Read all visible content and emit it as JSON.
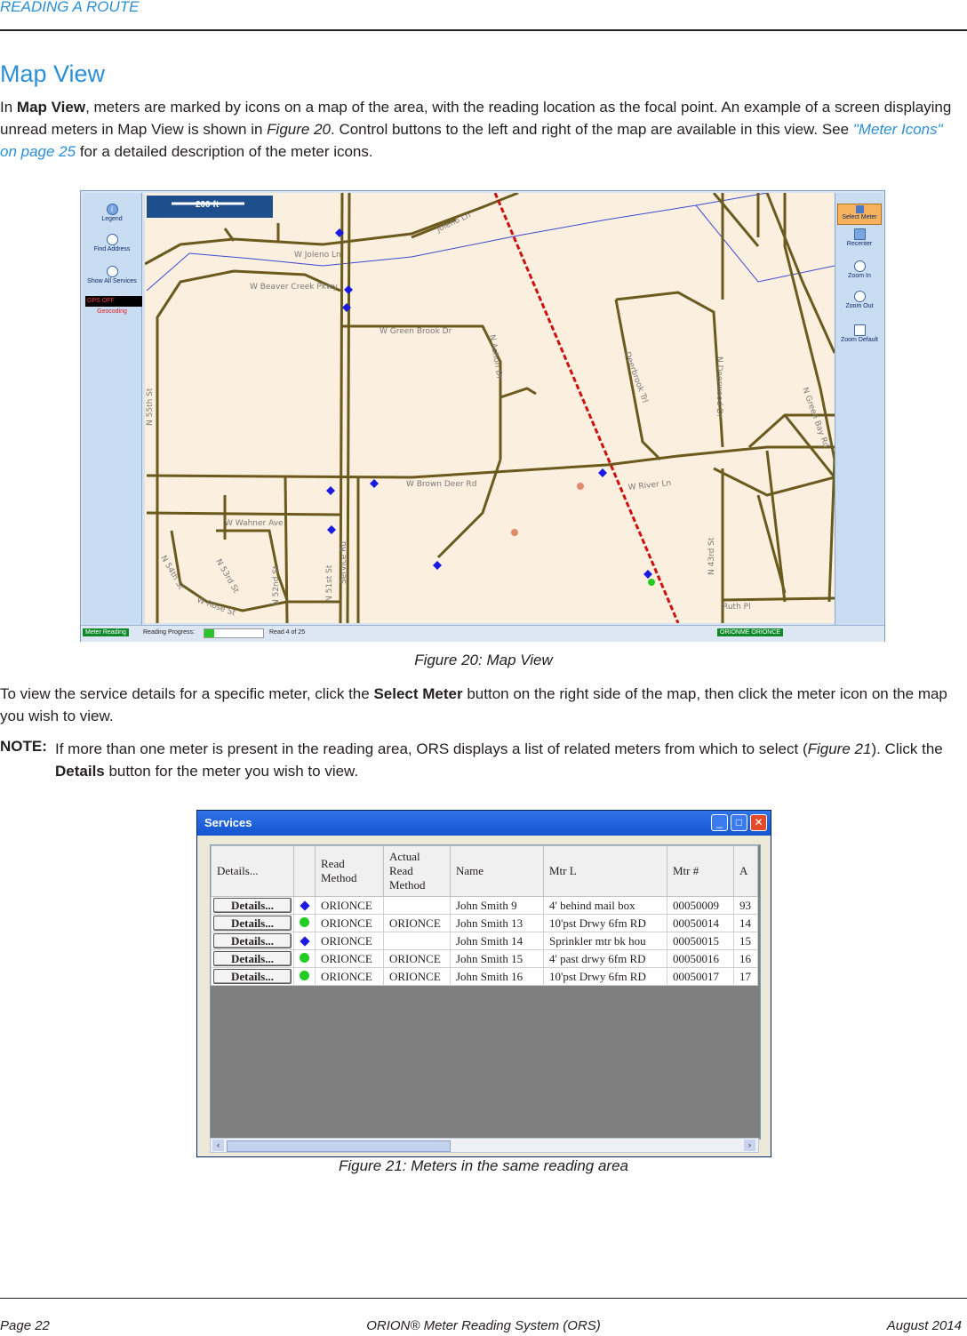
{
  "header": {
    "section": "READING A ROUTE"
  },
  "title": "Map View",
  "intro": {
    "p1_a": "In ",
    "p1_bold": "Map View",
    "p1_b": ", meters are marked by icons on a map of the area, with the reading location as the focal point. An example of a screen displaying unread meters in Map View is shown in ",
    "p1_fig": "Figure 20",
    "p1_c": ". Control buttons to the left and right of the map are available in this view. See ",
    "p1_link": "\"Meter Icons\" on page 25",
    "p1_d": " for a detailed description of the meter icons."
  },
  "figure20": {
    "caption": "Figure 20:  Map View",
    "scale": "200 ft",
    "left_tools": [
      "Legend",
      "Find Address",
      "Show All Services"
    ],
    "gps": "GPS OFF",
    "geocoding": "Geocoding",
    "right_tools": {
      "select": "Select Meter",
      "recenter": "Recenter",
      "zoom_in": "Zoom In",
      "zoom_out": "Zoom Out",
      "zoom_default": "Zoom Default"
    },
    "streets": {
      "joleno": "W Joleno Ln",
      "joleno2": "Joleno Ln",
      "beaver": "W Beaver Creek Pkwy",
      "greenbrook": "W Green Brook Dr",
      "ashon": "N Ashon Dr",
      "deerbrook": "Deerbrook Trl",
      "deerwood": "N Deerwood Dr",
      "greenbay": "N Green Bay Rd",
      "n55": "N 55th St",
      "browndeer": "W Brown Deer Rd",
      "river": "W River Ln",
      "wahner": "W Wahner Ave",
      "n54": "N 54th St",
      "n53": "N 53rd St",
      "n52": "N 52nd St",
      "n51": "N 51st St",
      "service": "Service Rd",
      "rose": "W Rose St",
      "n43": "N 43rd St",
      "ruth": "Ruth Pl"
    },
    "status": {
      "mode": "Meter Reading",
      "progress_label": "Reading Progress:",
      "progress_fraction": 0.16,
      "count": "Read 4 of 25",
      "method": "ORIONME  ORIONCE"
    }
  },
  "para2": {
    "a": "To view the service details for a specific meter, click the ",
    "bold": "Select Meter",
    "b": " button on the right side of the map, then click the meter icon on the map you wish to view."
  },
  "note": {
    "label": "NOTE:",
    "a": "If more than one meter is present in the reading area, ORS displays a list of related meters from which to select (",
    "fig": "Figure 21",
    "b": "). Click the ",
    "bold": "Details",
    "c": " button for the meter you wish to view."
  },
  "figure21": {
    "window_title": "Services",
    "caption": "Figure 21:  Meters in the same reading area",
    "columns": [
      "Details...",
      "",
      "Read Method",
      "Actual Read Method",
      "Name",
      "Mtr L",
      "Mtr #",
      "A"
    ],
    "button_label": "Details...",
    "rows": [
      {
        "icon": "blue-diamond",
        "read": "ORIONCE",
        "actual": "",
        "name": "John Smith 9",
        "loc": "4' behind mail box",
        "num": "00050009",
        "a": "93"
      },
      {
        "icon": "green-circle",
        "read": "ORIONCE",
        "actual": "ORIONCE",
        "name": "John Smith 13",
        "loc": "10'pst Drwy 6fm RD",
        "num": "00050014",
        "a": "14"
      },
      {
        "icon": "blue-diamond",
        "read": "ORIONCE",
        "actual": "",
        "name": "John Smith 14",
        "loc": "Sprinkler mtr bk hou",
        "num": "00050015",
        "a": "15"
      },
      {
        "icon": "green-circle",
        "read": "ORIONCE",
        "actual": "ORIONCE",
        "name": "John Smith 15",
        "loc": "4' past drwy 6fm RD",
        "num": "00050016",
        "a": "16"
      },
      {
        "icon": "green-circle",
        "read": "ORIONCE",
        "actual": "ORIONCE",
        "name": "John Smith 16",
        "loc": "10'pst Drwy 6fm RD",
        "num": "00050017",
        "a": "17"
      }
    ]
  },
  "footer": {
    "page": "Page 22",
    "product": "ORION® Meter Reading System (ORS)",
    "date": "August  2014"
  },
  "colors": {
    "accent": "#2b8fd6",
    "meter_unread": "#1a1ae0",
    "meter_read": "#22cc22",
    "road": "#6b5a1e",
    "rail": "#cc1010"
  }
}
